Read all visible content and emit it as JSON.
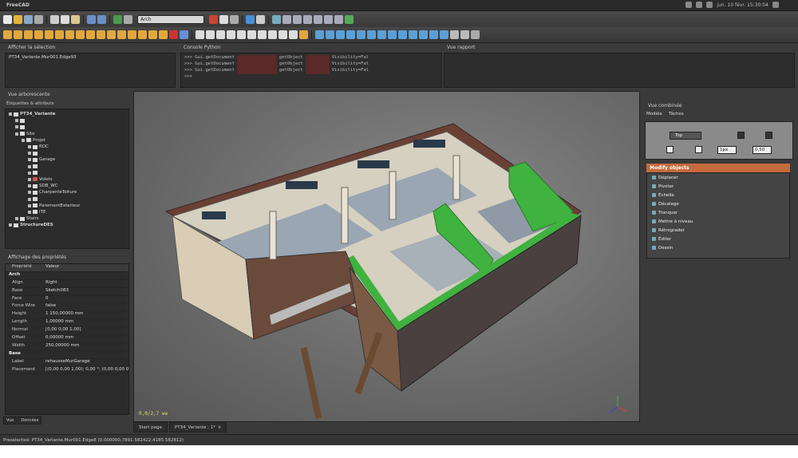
{
  "window": {
    "title": "FreeCAD",
    "clock": "jun. 10 févr. 15:30:04"
  },
  "toolbar": {
    "workbench": "Arch"
  },
  "panels": {
    "selection": {
      "title": "Afficher la sélection",
      "item": "PT34_Variante.Mur001.Edge93"
    },
    "python": {
      "title": "Console Python",
      "lines": [
        {
          "prompt": ">>> Gui.getDocument",
          "mid": "getObject",
          "tail": "Visibility=Fal"
        },
        {
          "prompt": ">>> Gui.getDocument",
          "mid": "getObject",
          "tail": "Visibility=Fal"
        },
        {
          "prompt": ">>> Gui.getDocument",
          "mid": "getObject",
          "tail": "Visibility=Fal"
        },
        {
          "prompt": ">>>",
          "mid": "",
          "tail": ""
        }
      ]
    },
    "report": {
      "title": "Vue rapport"
    }
  },
  "tree": {
    "title": "Vue arborescente",
    "header": "Étiquettes & attributs",
    "items": [
      {
        "label": "PT34_Variante",
        "depth": 0,
        "bold": true
      },
      {
        "label": "",
        "depth": 1
      },
      {
        "label": "",
        "depth": 1
      },
      {
        "label": "Site",
        "depth": 1
      },
      {
        "label": "Projet",
        "depth": 2
      },
      {
        "label": "RDC",
        "depth": 3
      },
      {
        "label": "",
        "depth": 3
      },
      {
        "label": "Garage",
        "depth": 3
      },
      {
        "label": "",
        "depth": 3
      },
      {
        "label": "",
        "depth": 3
      },
      {
        "label": "Volets",
        "depth": 3
      },
      {
        "label": "SDB_WC",
        "depth": 3
      },
      {
        "label": "CharpenteToiture",
        "depth": 3
      },
      {
        "label": "",
        "depth": 3
      },
      {
        "label": "ParementExterieur",
        "depth": 3
      },
      {
        "label": "ITE",
        "depth": 3
      },
      {
        "label": "Stairs",
        "depth": 1
      },
      {
        "label": "StructureDES",
        "depth": 0,
        "bold": true
      }
    ]
  },
  "properties": {
    "title": "Affichage des propriétés",
    "col_prop": "Propriété",
    "col_val": "Valeur",
    "rows": [
      {
        "k": "Arch",
        "v": "",
        "group": true
      },
      {
        "k": "Align",
        "v": "Right"
      },
      {
        "k": "Base",
        "v": "Sketch083"
      },
      {
        "k": "Face",
        "v": "0"
      },
      {
        "k": "Force Wire",
        "v": "false"
      },
      {
        "k": "Height",
        "v": "1 150,00000 mm"
      },
      {
        "k": "Length",
        "v": "1,00000 mm"
      },
      {
        "k": "Normal",
        "v": "[0,00 0,00 1,00]"
      },
      {
        "k": "Offset",
        "v": "0,00000 mm"
      },
      {
        "k": "Width",
        "v": "250,00000 mm"
      },
      {
        "k": "Base",
        "v": "",
        "group": true
      },
      {
        "k": "Label",
        "v": "rehausseMurGarage"
      },
      {
        "k": "Placement",
        "v": "[(0,00 0,00 1,00); 0,00 °; (0,00 0,00 0,00)]"
      }
    ],
    "tabs": [
      "Vue",
      "Données"
    ]
  },
  "viewport": {
    "coords": "0,0/2,7 ww"
  },
  "combo": {
    "title": "Vue combinée",
    "tabs": [
      "Modèle",
      "Tâches"
    ],
    "top_label": "Top",
    "spin1": "1px",
    "spin2": "0,50"
  },
  "modify": {
    "title": "Modify objects",
    "items": [
      "Déplacer",
      "Pivoter",
      "Échelle",
      "Décalage",
      "Tronquer",
      "Mettre à niveau",
      "Rétrograder",
      "Éditer",
      "Dessin"
    ]
  },
  "doc_tabs": [
    "Start page",
    "PT34_Variante : 1*"
  ],
  "status": "Preselected: PT34_Variante.Mur001.Edge8 (0.000000,7891.582422,4185.582812)",
  "colors": {
    "accent": "#c46a3c",
    "green": "#37b03a",
    "wall": "#e8e3d4",
    "roof": "#7a4a3a"
  }
}
